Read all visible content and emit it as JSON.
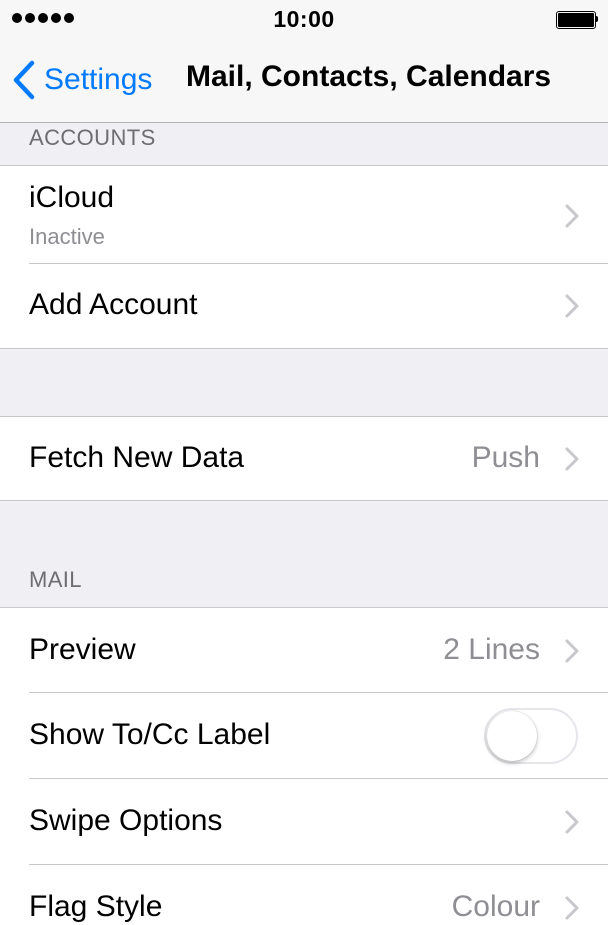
{
  "status_bar": {
    "time": "10:00",
    "signal_icon": "signal-dots-icon",
    "battery_icon": "battery-full-icon"
  },
  "nav": {
    "back_label": "Settings",
    "back_icon": "chevron-left-icon",
    "title": "Mail, Contacts, Calendars"
  },
  "accounts": {
    "header": "ACCOUNTS",
    "icloud": {
      "label": "iCloud",
      "sublabel": "Inactive"
    },
    "add_account": {
      "label": "Add Account"
    }
  },
  "fetch": {
    "label": "Fetch New Data",
    "value": "Push"
  },
  "mail": {
    "header": "MAIL",
    "preview": {
      "label": "Preview",
      "value": "2 Lines"
    },
    "show_tocc": {
      "label": "Show To/Cc Label",
      "enabled": false
    },
    "swipe_options": {
      "label": "Swipe Options"
    },
    "flag_style": {
      "label": "Flag Style",
      "value": "Colour"
    }
  },
  "colors": {
    "accent": "#007aff",
    "background": "#efeff4",
    "separator": "#c8c7cc",
    "secondary_text": "#8e8e93"
  }
}
